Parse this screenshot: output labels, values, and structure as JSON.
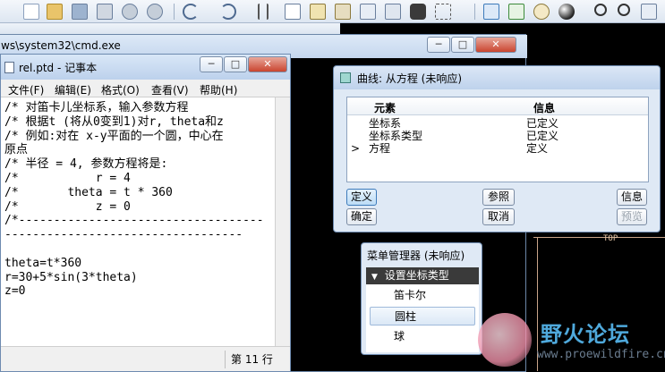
{
  "cmd_window": {
    "title": "ws\\system32\\cmd.exe"
  },
  "notepad": {
    "title": "rel.ptd - 记事本",
    "menu": [
      "文件(F)",
      "编辑(E)",
      "格式(O)",
      "查看(V)",
      "帮助(H)"
    ],
    "content": "/* 对笛卡儿坐标系，输入参数方程\n/* 根据t (将从0变到1)对r, theta和z\n/* 例如:对在 x-y平面的一个圆，中心在\n原点\n/* 半径 = 4, 参数方程将是:\n/*           r = 4\n/*       theta = t * 360\n/*           z = 0\n/*-----------------------------------\n----------------------------------\n\ntheta=t*360\nr=30+5*sin(3*theta)\nz=0",
    "status": "第 11 行"
  },
  "curve_dialog": {
    "title": "曲线: 从方程 (未响应)",
    "columns": [
      "元素",
      "信息"
    ],
    "rows": [
      {
        "element": "坐标系",
        "info": "已定义"
      },
      {
        "element": "坐标系类型",
        "info": "已定义"
      },
      {
        "element": "方程",
        "info": "定义"
      }
    ],
    "current_marker": ">",
    "buttons": {
      "define": "定义",
      "reference": "参照",
      "info": "信息",
      "ok": "确定",
      "cancel": "取消",
      "preview": "预览"
    }
  },
  "menu_manager": {
    "title": "菜单管理器 (未响应)",
    "header": "设置坐标类型",
    "items": [
      "笛卡尔",
      "圆柱",
      "球"
    ],
    "selected_index": 1
  },
  "graphics": {
    "label": "TOP"
  },
  "watermark": {
    "text": "野火论坛",
    "url": "www.proewildfire.cn"
  },
  "colors": {
    "accent": "#3d7bbb",
    "watermark": "#4fa9dc"
  }
}
